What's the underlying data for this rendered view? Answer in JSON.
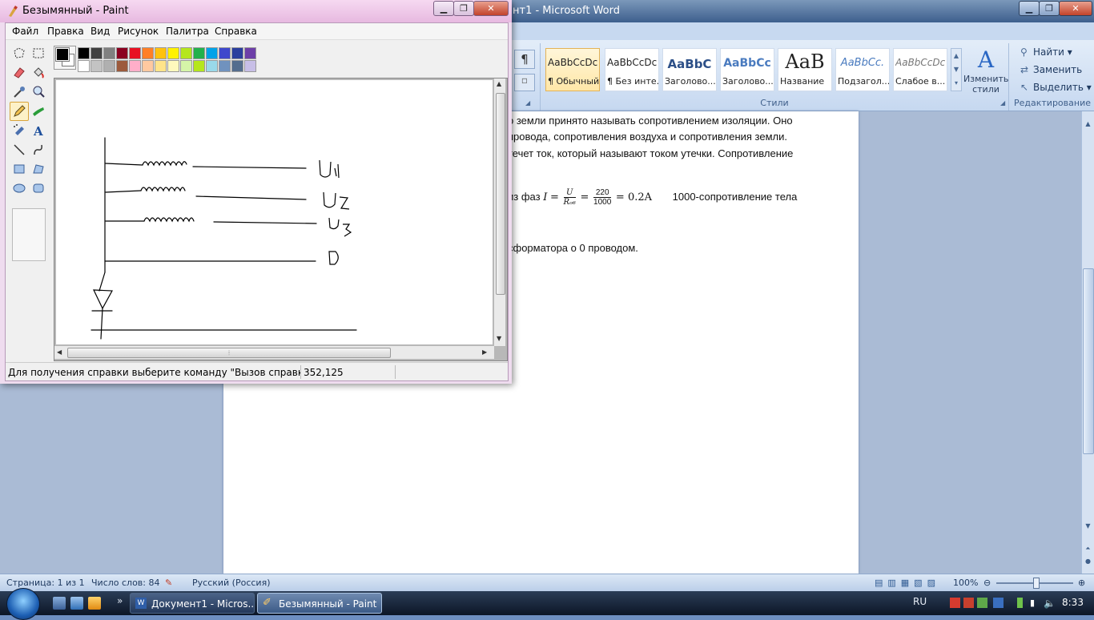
{
  "word": {
    "title": "нт1 - Microsoft Word",
    "pilcrow": "¶",
    "styles": [
      {
        "sample": "AaBbCcDc",
        "name": "¶ Обычный",
        "selected": true
      },
      {
        "sample": "AaBbCcDc",
        "name": "¶ Без инте...",
        "selected": false
      },
      {
        "sample": "AaBbC",
        "name": "Заголово...",
        "selected": false
      },
      {
        "sample": "AaBbCc",
        "name": "Заголово...",
        "selected": false
      },
      {
        "sample": "AaB",
        "name": "Название",
        "selected": false
      },
      {
        "sample": "AaBbCc.",
        "name": "Подзагол...",
        "selected": false
      },
      {
        "sample": "AaBbCcDc",
        "name": "Слабое в...",
        "selected": false
      }
    ],
    "change_styles": "Изменить стили",
    "styles_group_label": "Стили",
    "editing": {
      "find": "Найти",
      "replace": "Заменить",
      "select": "Выделить",
      "label": "Редактирование"
    },
    "doc_lines": [
      "о земли принято называть сопротивлением изоляции. Оно",
      " провода, сопротивления воздуха и сопротивления земли.",
      "течет ток, который называют током утечки. Сопротивление"
    ],
    "formula": {
      "prefix": "из фаз",
      "I": "I",
      "eq": "=",
      "num1": "U",
      "den1": "Rₒ₆",
      "num2": "220",
      "den2": "1000",
      "result": "= 0.2A",
      "note": "1000-сопротивление тела"
    },
    "doc_line_last": "сформатора о 0 проводом.",
    "status": {
      "page": "Страница: 1 из 1",
      "words": "Число слов: 84",
      "language": "Русский (Россия)",
      "zoom": "100%"
    }
  },
  "taskbar": {
    "more": "»",
    "word_task": "Документ1 - Micros...",
    "paint_task": "Безымянный - Paint",
    "lang": "RU",
    "clock": "8:33"
  },
  "paint": {
    "title": "Безымянный - Paint",
    "menu": [
      "Файл",
      "Правка",
      "Вид",
      "Рисунок",
      "Палитра",
      "Справка"
    ],
    "status_help": "Для получения справки выберите команду \"Вызов справки\" из ме",
    "coords": "352,125",
    "palette_top": [
      "#000000",
      "#404040",
      "#808080",
      "#8b0020",
      "#e81123",
      "#ff7f27",
      "#ffc20e",
      "#fff200",
      "#b5e61d",
      "#22b14c",
      "#00a2e8",
      "#3f48cc",
      "#2b3f9e",
      "#6d3fa8"
    ],
    "palette_bottom": [
      "#ffffff",
      "#c3c3c3",
      "#b0b0b0",
      "#9c5a3c",
      "#ffaec9",
      "#ffc9a0",
      "#ffe48a",
      "#fff9bd",
      "#d5f5a8",
      "#b5e61d",
      "#99d9ea",
      "#7092be",
      "#546d8e",
      "#c8bfe7"
    ],
    "drawing": {
      "labels": [
        "U1",
        "U2",
        "U3",
        "0"
      ]
    }
  }
}
